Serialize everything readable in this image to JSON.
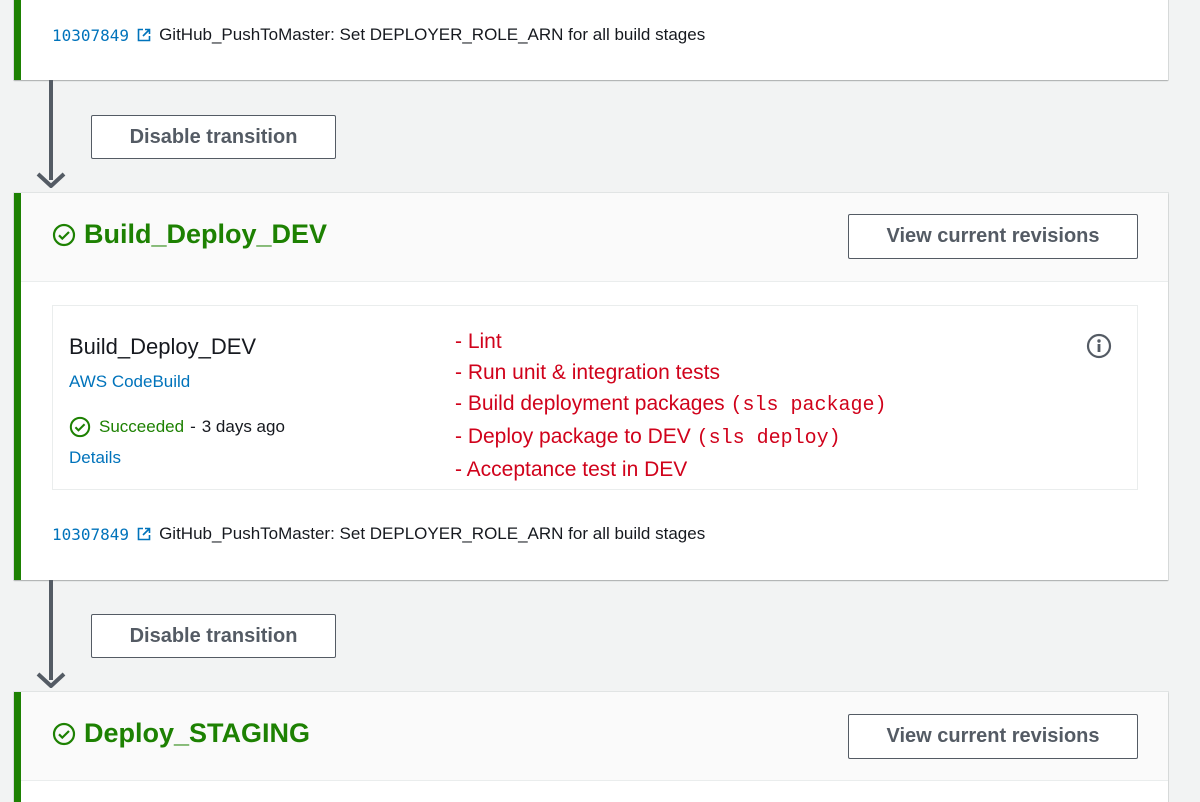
{
  "top_card": {
    "revision": {
      "id": "10307849",
      "message": "GitHub_PushToMaster: Set DEPLOYER_ROLE_ARN for all build stages",
      "icon": "external-link-icon"
    }
  },
  "transition_1": {
    "button_label": "Disable transition"
  },
  "stage_dev": {
    "title": "Build_Deploy_DEV",
    "status_icon": "success-check-icon",
    "view_button": "View current revisions",
    "action": {
      "name": "Build_Deploy_DEV",
      "provider": "AWS CodeBuild",
      "status": "Succeeded",
      "separator": "-",
      "time": "3 days ago",
      "details_link": "Details",
      "info_icon": "info-icon"
    },
    "notes": [
      {
        "text": "- Lint",
        "code": ""
      },
      {
        "text": "- Run unit & integration tests",
        "code": ""
      },
      {
        "text": "- Build deployment packages",
        "code": "(sls package)"
      },
      {
        "text": "- Deploy package to DEV",
        "code": "(sls deploy)"
      },
      {
        "text": "- Acceptance test in DEV",
        "code": ""
      }
    ],
    "revision": {
      "id": "10307849",
      "message": "GitHub_PushToMaster: Set DEPLOYER_ROLE_ARN for all build stages"
    }
  },
  "transition_2": {
    "button_label": "Disable transition"
  },
  "stage_staging": {
    "title": "Deploy_STAGING",
    "status_icon": "success-check-icon",
    "view_button": "View current revisions"
  },
  "colors": {
    "success": "#1d8102",
    "link": "#0073bb",
    "annotation": "#d0021b",
    "connector": "#545b64"
  }
}
